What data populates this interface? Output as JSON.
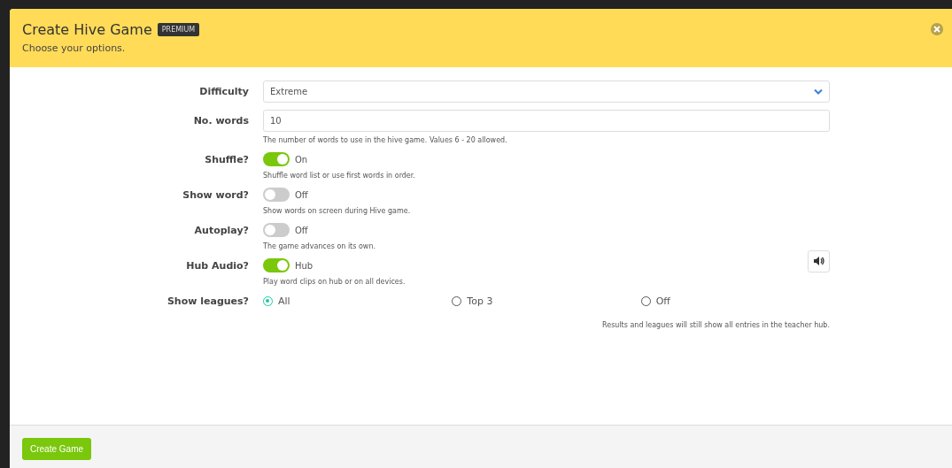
{
  "dialog": {
    "title": "Create Hive Game",
    "badge": "PREMIUM",
    "subtitle": "Choose your options."
  },
  "fields": [
    {
      "kind": "select",
      "label": "Difficulty",
      "value": "Extreme"
    },
    {
      "kind": "number",
      "label": "No. words",
      "value": "10",
      "help": "The number of words to use in the hive game. Values 6 - 20 allowed."
    },
    {
      "kind": "toggle",
      "label": "Shuffle?",
      "on": true,
      "state_label": "On",
      "help": "Shuffle word list or use first words in order."
    },
    {
      "kind": "toggle",
      "label": "Show word?",
      "on": false,
      "state_label": "Off",
      "help": "Show words on screen during Hive game."
    },
    {
      "kind": "toggle",
      "label": "Autoplay?",
      "on": false,
      "state_label": "Off",
      "help": "The game advances on its own."
    },
    {
      "kind": "toggle",
      "label": "Hub Audio?",
      "on": true,
      "state_label": "Hub",
      "help": "Play word clips on hub or on all devices.",
      "audio_button": true
    },
    {
      "kind": "radio",
      "label": "Show leagues?",
      "options": [
        {
          "label": "All",
          "selected": true
        },
        {
          "label": "Top 3",
          "selected": false
        },
        {
          "label": "Off",
          "selected": false
        }
      ],
      "note": "Results and leagues will still show all entries in the teacher hub."
    }
  ],
  "footer": {
    "button": "Create Game"
  }
}
